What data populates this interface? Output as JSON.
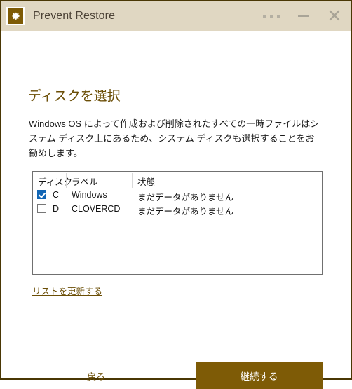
{
  "window": {
    "title": "Prevent Restore",
    "icon": "gear-icon",
    "border_color": "#4a3704",
    "titlebar_color": "#e0d7c2",
    "controls": {
      "menu": "⋯",
      "minimize": "—",
      "close": "✕"
    }
  },
  "main": {
    "heading": "ディスクを選択",
    "description": "Windows OS によって作成および削除されたすべての一時ファイルはシステム ディスク上にあるため、システム ディスクも選択することをお勧めします。",
    "accent_color": "#6b4e06"
  },
  "table": {
    "headers": [
      "ディスク",
      "ラベル",
      "状態",
      ""
    ],
    "rows": [
      {
        "checked": true,
        "disk": "C",
        "label": "Windows",
        "state": "まだデータがありません"
      },
      {
        "checked": false,
        "disk": "D",
        "label": "CLOVERCD",
        "state": "まだデータがありません"
      }
    ],
    "checkbox_checked_color": "#1266b5"
  },
  "links": {
    "refresh": "リストを更新する",
    "back": "戻る"
  },
  "buttons": {
    "continue": "継続する",
    "continue_color": "#7e5b06"
  }
}
